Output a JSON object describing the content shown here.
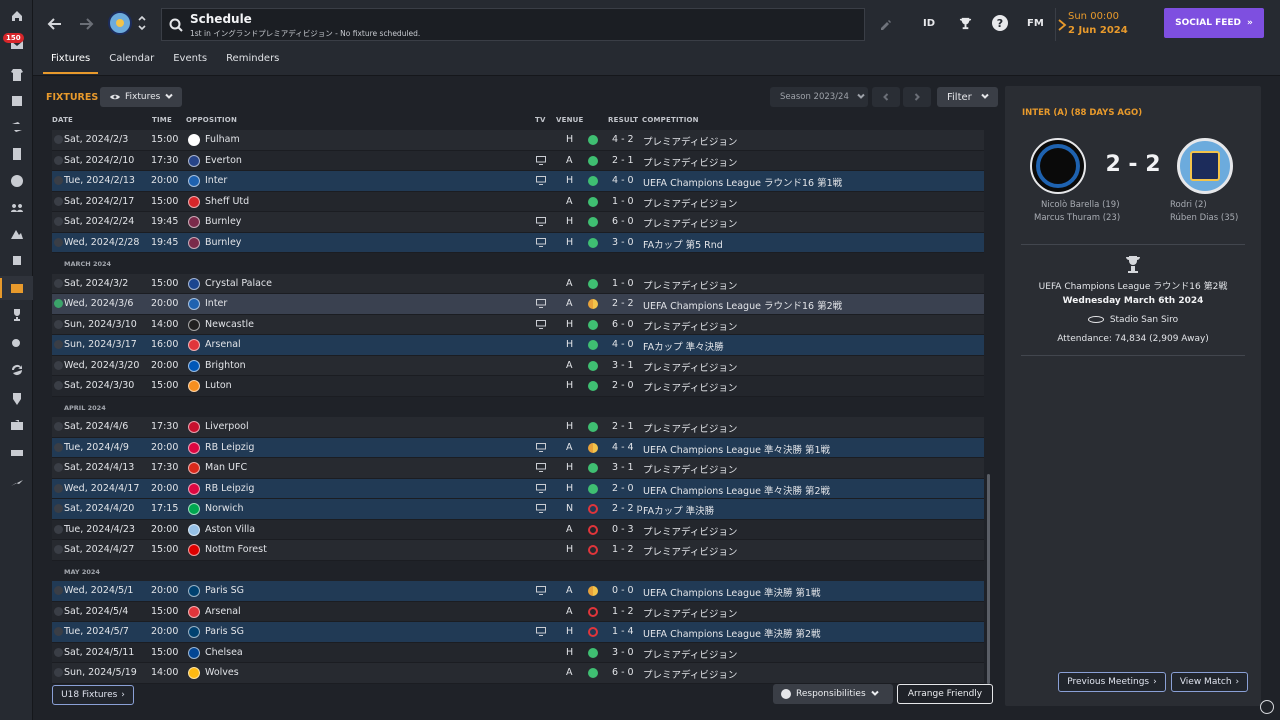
{
  "rail": {
    "badge": "150",
    "items": [
      "home-icon",
      "inbox-icon",
      "squad-icon",
      "squad-planner-icon",
      "transfers-icon",
      "scouting-icon",
      "data-hub-icon",
      "staff-icon",
      "training-icon",
      "medical-icon",
      "schedule-icon",
      "competitions-icon",
      "search-icon",
      "refresh-icon",
      "club-vision-icon",
      "finances-icon",
      "dev-centre-icon",
      "exit-icon"
    ]
  },
  "header": {
    "title": "Schedule",
    "subtitle": "1st in イングランドプレミアディビジョン - No fixture scheduled.",
    "icons": {
      "id": "ID",
      "fm": "FM",
      "help": "?"
    },
    "date_day": "Sun 00:00",
    "date_date": "2 Jun 2024",
    "social_feed": "SOCIAL FEED"
  },
  "tabs": [
    {
      "label": "Fixtures"
    },
    {
      "label": "Calendar"
    },
    {
      "label": "Events"
    },
    {
      "label": "Reminders"
    }
  ],
  "toolbar": {
    "section_title": "FIXTURES",
    "view_dropdown": "Fixtures",
    "season": "Season 2023/24",
    "filter": "Filter"
  },
  "columns": {
    "date": "DATE",
    "time": "TIME",
    "opposition": "OPPOSITION",
    "tv": "TV",
    "venue": "VENUE",
    "result": "RESULT",
    "competition": "COMPETITION"
  },
  "rows": [
    {
      "type": "match",
      "date": "Sat, 2024/2/3",
      "time": "15:00",
      "opp": "Fulham",
      "crest": "#ffffff",
      "tv": false,
      "venue": "H",
      "res": "w",
      "score": "4 - 2",
      "comp": "プレミアディビジョン",
      "hl": false
    },
    {
      "type": "match",
      "date": "Sat, 2024/2/10",
      "time": "17:30",
      "opp": "Everton",
      "crest": "#274488",
      "tv": true,
      "venue": "A",
      "res": "w",
      "score": "2 - 1",
      "comp": "プレミアディビジョン",
      "hl": false
    },
    {
      "type": "match",
      "date": "Tue, 2024/2/13",
      "time": "20:00",
      "opp": "Inter",
      "crest": "#1e62b0",
      "tv": true,
      "venue": "H",
      "res": "w",
      "score": "4 - 0",
      "comp": "UEFA Champions League ラウンド16 第1戦",
      "hl": true
    },
    {
      "type": "match",
      "date": "Sat, 2024/2/17",
      "time": "15:00",
      "opp": "Sheff Utd",
      "crest": "#d7262a",
      "tv": false,
      "venue": "A",
      "res": "w",
      "score": "1 - 0",
      "comp": "プレミアディビジョン",
      "hl": false
    },
    {
      "type": "match",
      "date": "Sat, 2024/2/24",
      "time": "19:45",
      "opp": "Burnley",
      "crest": "#7a2a4a",
      "tv": true,
      "venue": "H",
      "res": "w",
      "score": "6 - 0",
      "comp": "プレミアディビジョン",
      "hl": false
    },
    {
      "type": "match",
      "date": "Wed, 2024/2/28",
      "time": "19:45",
      "opp": "Burnley",
      "crest": "#7a2a4a",
      "tv": true,
      "venue": "H",
      "res": "w",
      "score": "3 - 0",
      "comp": "FAカップ 第5 Rnd",
      "hl": true
    },
    {
      "type": "month",
      "label": "MARCH 2024"
    },
    {
      "type": "match",
      "date": "Sat, 2024/3/2",
      "time": "15:00",
      "opp": "Crystal Palace",
      "crest": "#1b458f",
      "tv": false,
      "venue": "A",
      "res": "w",
      "score": "1 - 0",
      "comp": "プレミアディビジョン",
      "hl": false
    },
    {
      "type": "match",
      "date": "Wed, 2024/3/6",
      "time": "20:00",
      "opp": "Inter",
      "crest": "#1e62b0",
      "tv": true,
      "venue": "A",
      "res": "d",
      "score": "2 - 2",
      "comp": "UEFA Champions League ラウンド16 第2戦",
      "hl": false,
      "sel": true
    },
    {
      "type": "match",
      "date": "Sun, 2024/3/10",
      "time": "14:00",
      "opp": "Newcastle",
      "crest": "#202020",
      "tv": true,
      "venue": "H",
      "res": "w",
      "score": "6 - 0",
      "comp": "プレミアディビジョン",
      "hl": false
    },
    {
      "type": "match",
      "date": "Sun, 2024/3/17",
      "time": "16:00",
      "opp": "Arsenal",
      "crest": "#e0353b",
      "tv": false,
      "venue": "H",
      "res": "w",
      "score": "4 - 0",
      "comp": "FAカップ 準々決勝",
      "hl": true
    },
    {
      "type": "match",
      "date": "Wed, 2024/3/20",
      "time": "20:00",
      "opp": "Brighton",
      "crest": "#0057b8",
      "tv": false,
      "venue": "A",
      "res": "w",
      "score": "3 - 1",
      "comp": "プレミアディビジョン",
      "hl": false
    },
    {
      "type": "match",
      "date": "Sat, 2024/3/30",
      "time": "15:00",
      "opp": "Luton",
      "crest": "#f78f1e",
      "tv": false,
      "venue": "H",
      "res": "w",
      "score": "2 - 0",
      "comp": "プレミアディビジョン",
      "hl": false
    },
    {
      "type": "month",
      "label": "APRIL 2024"
    },
    {
      "type": "match",
      "date": "Sat, 2024/4/6",
      "time": "17:30",
      "opp": "Liverpool",
      "crest": "#c8102e",
      "tv": false,
      "venue": "H",
      "res": "w",
      "score": "2 - 1",
      "comp": "プレミアディビジョン",
      "hl": false
    },
    {
      "type": "match",
      "date": "Tue, 2024/4/9",
      "time": "20:00",
      "opp": "RB Leipzig",
      "crest": "#dd0741",
      "tv": true,
      "venue": "A",
      "res": "d",
      "score": "4 - 4",
      "comp": "UEFA Champions League 準々決勝 第1戦",
      "hl": true
    },
    {
      "type": "match",
      "date": "Sat, 2024/4/13",
      "time": "17:30",
      "opp": "Man UFC",
      "crest": "#da291c",
      "tv": true,
      "venue": "H",
      "res": "w",
      "score": "3 - 1",
      "comp": "プレミアディビジョン",
      "hl": false
    },
    {
      "type": "match",
      "date": "Wed, 2024/4/17",
      "time": "20:00",
      "opp": "RB Leipzig",
      "crest": "#dd0741",
      "tv": true,
      "venue": "H",
      "res": "w",
      "score": "2 - 0",
      "comp": "UEFA Champions League 準々決勝 第2戦",
      "hl": true
    },
    {
      "type": "match",
      "date": "Sat, 2024/4/20",
      "time": "17:15",
      "opp": "Norwich",
      "crest": "#00a650",
      "tv": true,
      "venue": "N",
      "res": "l",
      "score": "2 - 2 p",
      "comp": "FAカップ 準決勝",
      "hl": true
    },
    {
      "type": "match",
      "date": "Tue, 2024/4/23",
      "time": "20:00",
      "opp": "Aston Villa",
      "crest": "#95bfe5",
      "tv": false,
      "venue": "A",
      "res": "l",
      "score": "0 - 3",
      "comp": "プレミアディビジョン",
      "hl": false
    },
    {
      "type": "match",
      "date": "Sat, 2024/4/27",
      "time": "15:00",
      "opp": "Nottm Forest",
      "crest": "#dd0000",
      "tv": false,
      "venue": "H",
      "res": "l",
      "score": "1 - 2",
      "comp": "プレミアディビジョン",
      "hl": false
    },
    {
      "type": "month",
      "label": "MAY 2024"
    },
    {
      "type": "match",
      "date": "Wed, 2024/5/1",
      "time": "20:00",
      "opp": "Paris SG",
      "crest": "#004170",
      "tv": true,
      "venue": "A",
      "res": "d",
      "score": "0 - 0",
      "comp": "UEFA Champions League 準決勝 第1戦",
      "hl": true
    },
    {
      "type": "match",
      "date": "Sat, 2024/5/4",
      "time": "15:00",
      "opp": "Arsenal",
      "crest": "#e0353b",
      "tv": false,
      "venue": "A",
      "res": "l",
      "score": "1 - 2",
      "comp": "プレミアディビジョン",
      "hl": false
    },
    {
      "type": "match",
      "date": "Tue, 2024/5/7",
      "time": "20:00",
      "opp": "Paris SG",
      "crest": "#004170",
      "tv": true,
      "venue": "H",
      "res": "l",
      "score": "1 - 4",
      "comp": "UEFA Champions League 準決勝 第2戦",
      "hl": true
    },
    {
      "type": "match",
      "date": "Sat, 2024/5/11",
      "time": "15:00",
      "opp": "Chelsea",
      "crest": "#034694",
      "tv": false,
      "venue": "H",
      "res": "w",
      "score": "3 - 0",
      "comp": "プレミアディビジョン",
      "hl": false
    },
    {
      "type": "match",
      "date": "Sun, 2024/5/19",
      "time": "14:00",
      "opp": "Wolves",
      "crest": "#fdb913",
      "tv": false,
      "venue": "A",
      "res": "w",
      "score": "6 - 0",
      "comp": "プレミアディビジョン",
      "hl": false
    }
  ],
  "footer": {
    "u18": "U18 Fixtures",
    "responsibilities": "Responsibilities",
    "arrange": "Arrange Friendly"
  },
  "side": {
    "title": "INTER (A) (88 DAYS AGO)",
    "score": "2 - 2",
    "home_scorers": [
      "Nicolò Barella (19)",
      "Marcus Thuram (23)"
    ],
    "away_scorers": [
      "Rodri (2)",
      "Rúben Dias (35)"
    ],
    "competition": "UEFA Champions League ラウンド16 第2戦",
    "date": "Wednesday March 6th 2024",
    "stadium": "Stadio San Siro",
    "attendance": "Attendance: 74,834 (2,909 Away)",
    "prev_meetings": "Previous Meetings",
    "view_match": "View Match"
  }
}
